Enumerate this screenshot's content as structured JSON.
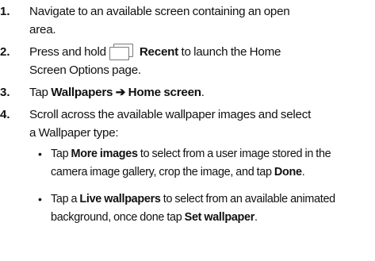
{
  "steps": [
    {
      "number": "1.",
      "lines": [
        "Navigate to an available screen containing an open",
        "area."
      ]
    },
    {
      "number": "2.",
      "pre": "Press and hold",
      "icon": "recent-apps-icon",
      "bold": "Recent",
      "post": "to launch the Home",
      "line2": "Screen Options page."
    },
    {
      "number": "3.",
      "pre": "Tap",
      "bold1": "Wallpapers",
      "arrow": "➔",
      "bold2": "Home screen",
      "post": "."
    },
    {
      "number": "4.",
      "lines": [
        "Scroll across the available wallpaper images and select",
        "a Wallpaper type:"
      ]
    }
  ],
  "sub_items": [
    {
      "bullet": "•",
      "pre": "Tap",
      "bold1": "More images",
      "mid": "to select from a user image stored in the",
      "line2_pre": "camera image gallery, crop the image, and tap",
      "bold2": "Done",
      "line2_post": "."
    },
    {
      "bullet": "•",
      "pre": "Tap a",
      "bold1": "Live wallpapers",
      "mid": "to select from an available animated",
      "line2_pre": "background, once done tap",
      "bold2": "Set wallpaper",
      "line2_post": "."
    }
  ]
}
